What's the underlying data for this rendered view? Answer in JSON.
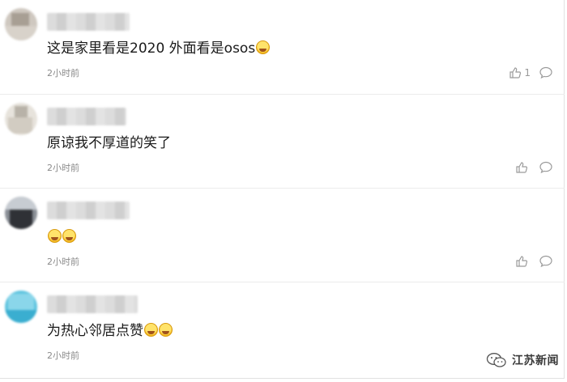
{
  "comments": [
    {
      "text": "这是家里看是2020 外面看是osos",
      "emoji_count": 1,
      "time": "2小时前",
      "likes": "1"
    },
    {
      "text": "原谅我不厚道的笑了",
      "emoji_count": 0,
      "time": "2小时前",
      "likes": ""
    },
    {
      "text": "",
      "emoji_count": 2,
      "time": "2小时前",
      "likes": ""
    },
    {
      "text": "为热心邻居点赞",
      "emoji_count": 2,
      "time": "2小时前",
      "likes": ""
    }
  ],
  "icons": {
    "like": "thumbs-up-icon",
    "reply": "comment-bubble-icon",
    "emoji": "laughing-tears-emoji",
    "watermark": "wechat-logo-icon"
  },
  "watermark": {
    "text": "江苏新闻"
  }
}
